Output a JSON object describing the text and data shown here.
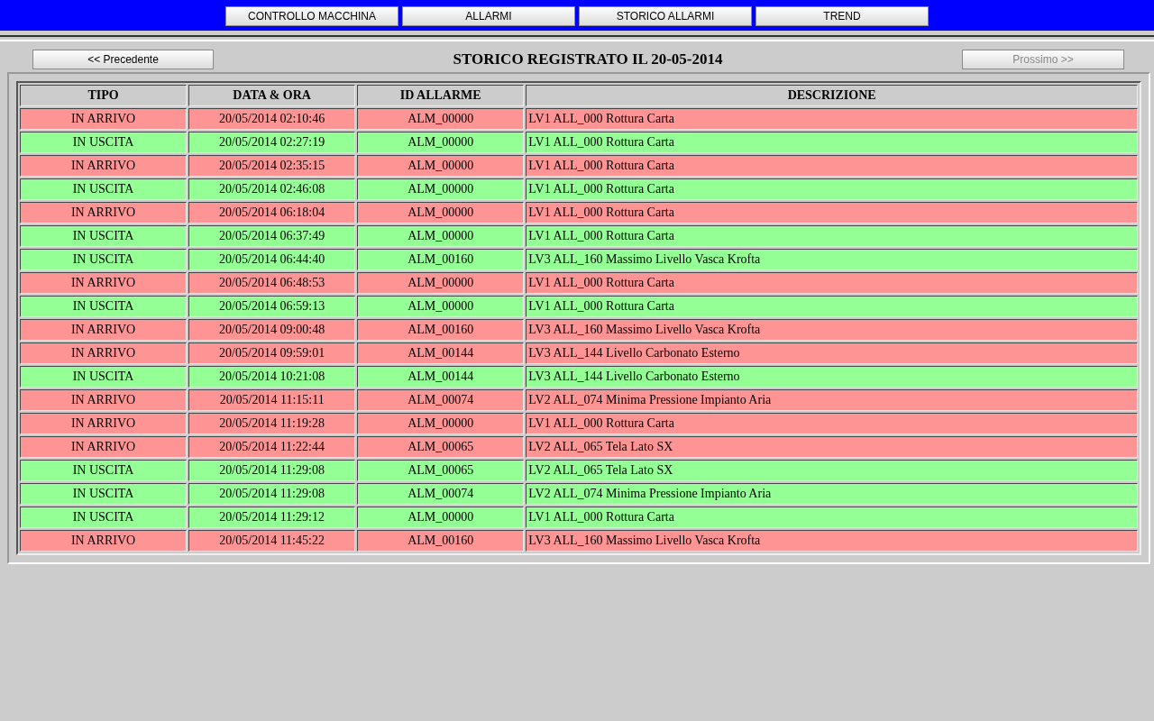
{
  "nav_buttons": [
    {
      "label": "CONTROLLO MACCHINA"
    },
    {
      "label": "ALLARMI"
    },
    {
      "label": "STORICO ALLARMI"
    },
    {
      "label": "TREND"
    }
  ],
  "prev_button": {
    "label": "<< Precedente",
    "disabled": false
  },
  "title": "STORICO REGISTRATO IL 20-05-2014",
  "next_button": {
    "label": "Prossimo >>",
    "disabled": true
  },
  "table": {
    "columns": [
      "TIPO",
      "DATA & ORA",
      "ID ALLARME",
      "DESCRIZIONE"
    ],
    "rows": [
      {
        "kind": "in",
        "cells": [
          "IN ARRIVO",
          "20/05/2014 02:10:46",
          "ALM_00000",
          "LV1 ALL_000 Rottura Carta"
        ]
      },
      {
        "kind": "out",
        "cells": [
          "IN USCITA",
          "20/05/2014 02:27:19",
          "ALM_00000",
          "LV1 ALL_000 Rottura Carta"
        ]
      },
      {
        "kind": "in",
        "cells": [
          "IN ARRIVO",
          "20/05/2014 02:35:15",
          "ALM_00000",
          "LV1 ALL_000 Rottura Carta"
        ]
      },
      {
        "kind": "out",
        "cells": [
          "IN USCITA",
          "20/05/2014 02:46:08",
          "ALM_00000",
          "LV1 ALL_000 Rottura Carta"
        ]
      },
      {
        "kind": "in",
        "cells": [
          "IN ARRIVO",
          "20/05/2014 06:18:04",
          "ALM_00000",
          "LV1 ALL_000 Rottura Carta"
        ]
      },
      {
        "kind": "out",
        "cells": [
          "IN USCITA",
          "20/05/2014 06:37:49",
          "ALM_00000",
          "LV1 ALL_000 Rottura Carta"
        ]
      },
      {
        "kind": "out",
        "cells": [
          "IN USCITA",
          "20/05/2014 06:44:40",
          "ALM_00160",
          "LV3 ALL_160 Massimo Livello Vasca Krofta"
        ]
      },
      {
        "kind": "in",
        "cells": [
          "IN ARRIVO",
          "20/05/2014 06:48:53",
          "ALM_00000",
          "LV1 ALL_000 Rottura Carta"
        ]
      },
      {
        "kind": "out",
        "cells": [
          "IN USCITA",
          "20/05/2014 06:59:13",
          "ALM_00000",
          "LV1 ALL_000 Rottura Carta"
        ]
      },
      {
        "kind": "in",
        "cells": [
          "IN ARRIVO",
          "20/05/2014 09:00:48",
          "ALM_00160",
          "LV3 ALL_160 Massimo Livello Vasca Krofta"
        ]
      },
      {
        "kind": "in",
        "cells": [
          "IN ARRIVO",
          "20/05/2014 09:59:01",
          "ALM_00144",
          "LV3 ALL_144 Livello Carbonato Esterno"
        ]
      },
      {
        "kind": "out",
        "cells": [
          "IN USCITA",
          "20/05/2014 10:21:08",
          "ALM_00144",
          "LV3 ALL_144 Livello Carbonato Esterno"
        ]
      },
      {
        "kind": "in",
        "cells": [
          "IN ARRIVO",
          "20/05/2014 11:15:11",
          "ALM_00074",
          "LV2 ALL_074 Minima Pressione Impianto Aria"
        ]
      },
      {
        "kind": "in",
        "cells": [
          "IN ARRIVO",
          "20/05/2014 11:19:28",
          "ALM_00000",
          "LV1 ALL_000 Rottura Carta"
        ]
      },
      {
        "kind": "in",
        "cells": [
          "IN ARRIVO",
          "20/05/2014 11:22:44",
          "ALM_00065",
          "LV2 ALL_065 Tela Lato SX"
        ]
      },
      {
        "kind": "out",
        "cells": [
          "IN USCITA",
          "20/05/2014 11:29:08",
          "ALM_00065",
          "LV2 ALL_065 Tela Lato SX"
        ]
      },
      {
        "kind": "out",
        "cells": [
          "IN USCITA",
          "20/05/2014 11:29:08",
          "ALM_00074",
          "LV2 ALL_074 Minima Pressione Impianto Aria"
        ]
      },
      {
        "kind": "out",
        "cells": [
          "IN USCITA",
          "20/05/2014 11:29:12",
          "ALM_00000",
          "LV1 ALL_000 Rottura Carta"
        ]
      },
      {
        "kind": "in",
        "cells": [
          "IN ARRIVO",
          "20/05/2014 11:45:22",
          "ALM_00160",
          "LV3 ALL_160 Massimo Livello Vasca Krofta"
        ]
      }
    ]
  }
}
